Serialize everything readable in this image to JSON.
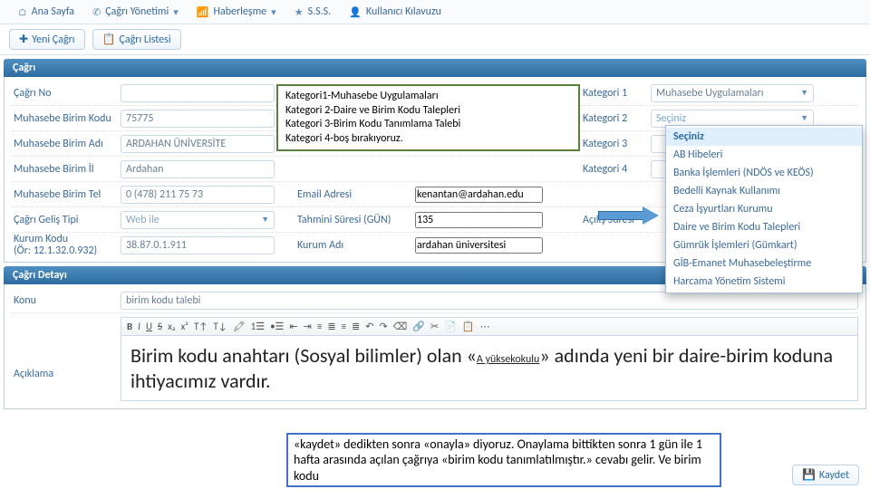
{
  "nav": {
    "home": "Ana Sayfa",
    "cagri": "Çağrı Yönetimi",
    "haber": "Haberleşme",
    "sss": "S.S.S.",
    "kilavuz": "Kullanıcı Kılavuzu"
  },
  "buttons": {
    "yeni": "Yeni Çağrı",
    "liste": "Çağrı Listesi",
    "kaydet": "Kaydet"
  },
  "panel1": "Çağrı",
  "panel2": "Çağrı Detayı",
  "labels": {
    "cagriNo": "Çağrı No",
    "muhKod": "Muhasebe Birim Kodu",
    "muhAd": "Muhasebe Birim Adı",
    "muhIl": "Muhasebe Birim İl",
    "muhTel": "Muhasebe Birim Tel",
    "gelis": "Çağrı Geliş Tipi",
    "kurumKod": "Kurum Kodu\n(Ör: 12.1.32.0.932)",
    "email": "Email Adresi",
    "sure": "Tahmini Süresi (GÜN)",
    "kurumAd": "Kurum Adı",
    "kat1": "Kategori 1",
    "kat2": "Kategori 2",
    "kat3": "Kategori 3",
    "kat4": "Kategori 4",
    "acilis": "Açılış Süresi",
    "konu": "Konu",
    "aciklama": "Açıklama"
  },
  "values": {
    "cagriNo": "",
    "muhKod": "75775",
    "muhAd": "ARDAHAN ÜNİVERSİTE",
    "muhIl": "Ardahan",
    "muhTel": "0 (478) 211 75 73",
    "gelis": "Web ile",
    "kurumKod": "38.87.0.1.911",
    "email": "kenantan@ardahan.edu",
    "sure": "135",
    "kurumAd": "ardahan üniversitesi",
    "kat1": "Muhasebe Uygulamaları",
    "kat2": "Seçiniz",
    "konu": "birim kodu talebi"
  },
  "dropdown": [
    "Seçiniz",
    "AB Hibeleri",
    "Banka İşlemleri (NDÖS ve KEÖS)",
    "Bedelli Kaynak Kullanımı",
    "Ceza İşyurtları Kurumu",
    "Daire ve Birim Kodu Talepleri",
    "Gümrük İşlemleri (Gümkart)",
    "GİB-Emanet Muhasebeleştirme",
    "Harcama Yönetim Sistemi"
  ],
  "dropdownSelected": 0,
  "callout1": {
    "l1": "Kategori1-Muhasebe Uygulamaları",
    "l2": "Kategori 2-Daire ve Birim Kodu Talepleri",
    "l3": "Kategori 3-Birim Kodu Tanımlama Talebi",
    "l4": "Kategori 4-boş bırakıyoruz."
  },
  "editor": "Birim kodu anahtarı (Sosyal bilimler) olan «A yüksekokulu» adında yeni bir daire-birim koduna ihtiyacımız vardır.",
  "callout2": " «kaydet» dedikten sonra «onayla» diyoruz. Onaylama bittikten sonra 1 gün ile 1 hafta arasında açılan çağrıya «birim kodu tanımlatılmıştır.» cevabı gelir. Ve birim kodu"
}
